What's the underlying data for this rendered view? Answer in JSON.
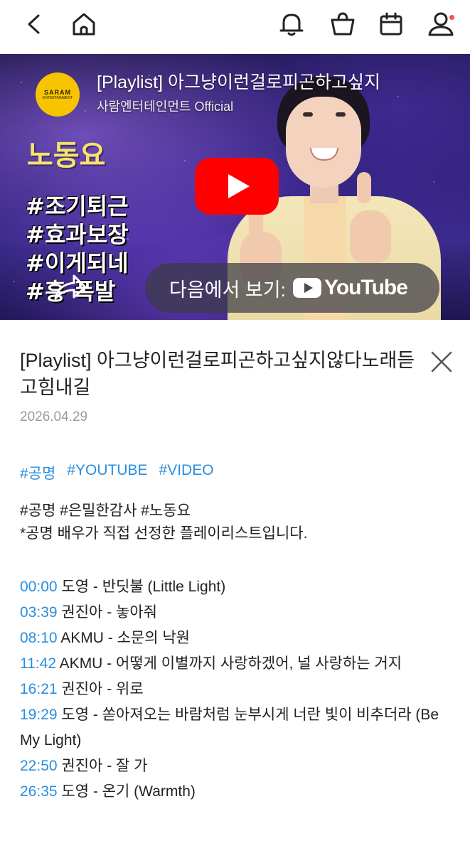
{
  "topbar": {
    "icons": [
      "back-arrow-icon",
      "home-icon",
      "bell-icon",
      "shopping-bag-icon",
      "calendar-icon",
      "user-icon"
    ],
    "notification_dot_color": "#f4554a"
  },
  "video": {
    "channel_logo_text": "SARAM",
    "channel_logo_subtext": "ENTERTAINMENT",
    "title": "[Playlist] 아그냥이런걸로피곤하고싶지",
    "channel_name": "사람엔터테인먼트 Official",
    "thumbnail_headline": "노동요",
    "thumbnail_hashtags": [
      "#조기퇴근",
      "#효과보장",
      "#이게되네",
      "#흥 폭발"
    ],
    "watch_on_label": "다음에서 보기:",
    "youtube_label": "YouTube",
    "play_button_color": "#ff0000"
  },
  "post": {
    "title": "[Playlist] 아그냥이런걸로피곤하고싶지않다노래듣고힘내길",
    "date": "2026.04.29",
    "tags": [
      "#공명",
      "#YOUTUBE",
      "#VIDEO"
    ],
    "description_line1": "#공명 #은밀한감사 #노동요",
    "description_line2": "*공명 배우가 직접 선정한 플레이리스트입니다.",
    "tracks": [
      {
        "time": "00:00",
        "title": " 도영 - 반딧불 (Little Light)"
      },
      {
        "time": "03:39",
        "title": " 권진아 - 놓아줘"
      },
      {
        "time": "08:10",
        "title": " AKMU - 소문의 낙원"
      },
      {
        "time": "11:42",
        "title": " AKMU - 어떻게 이별까지 사랑하겠어, 널 사랑하는 거지"
      },
      {
        "time": "16:21",
        "title": " 권진아 - 위로"
      },
      {
        "time": "19:29",
        "title": " 도영 - 쏟아져오는 바람처럼 눈부시게 너란 빛이 비추더라 (Be My Light)"
      },
      {
        "time": "22:50",
        "title": " 권진아 - 잘 가"
      },
      {
        "time": "26:35",
        "title": " 도영 - 온기 (Warmth)"
      }
    ],
    "link_color": "#2a8ee0"
  }
}
